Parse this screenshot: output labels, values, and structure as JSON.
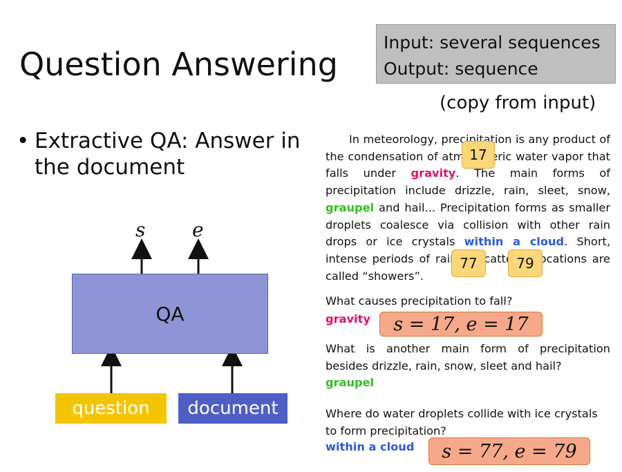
{
  "slide": {
    "title": "Question Answering",
    "io_box": {
      "line1": "Input: several sequences",
      "line2": "Output: sequence"
    },
    "copy_note": "(copy from input)",
    "bullet": "Extractive QA: Answer in the document"
  },
  "diagram": {
    "qa_label": "QA",
    "question_label": "question",
    "document_label": "document",
    "output_s": "s",
    "output_e": "e"
  },
  "passage": {
    "part1": "In meteorology, precipitation is any product of the condensation of atmospheric water vapor that falls under ",
    "gravity": "gravity",
    "part2": ". The main forms of precipitation include drizzle, rain, sleet, snow, ",
    "graupel": "graupel",
    "part3": " and hail... Precipitation forms as smaller droplets coalesce via collision with other rain drops or ice crystals ",
    "within_a_cloud": "within a cloud",
    "part4": ". Short, intense periods of rain in scattered locations are called “showers”."
  },
  "badges": {
    "b17": "17",
    "b77": "77",
    "b79": "79"
  },
  "questions": [
    {
      "question": "What causes precipitation to fall?",
      "answer": "gravity",
      "span": "s = 17, e = 17"
    },
    {
      "question": "What is another main form of precipitation besides drizzle, rain, snow, sleet and hail?",
      "answer": "graupel"
    },
    {
      "question": "Where do water droplets collide with ice crystals to form precipitation?",
      "answer": "within a cloud",
      "span": "s = 77, e = 79"
    }
  ],
  "colors": {
    "qa_box": "#8f94d6",
    "question_box": "#f5c400",
    "document_box": "#4e5ec4",
    "io_box": "#bfbfbf",
    "answer_red": "#e0106e",
    "answer_green": "#30c020",
    "answer_blue": "#2a5ad8",
    "badge": "#fbd77a",
    "span_box": "#f6a98a"
  }
}
